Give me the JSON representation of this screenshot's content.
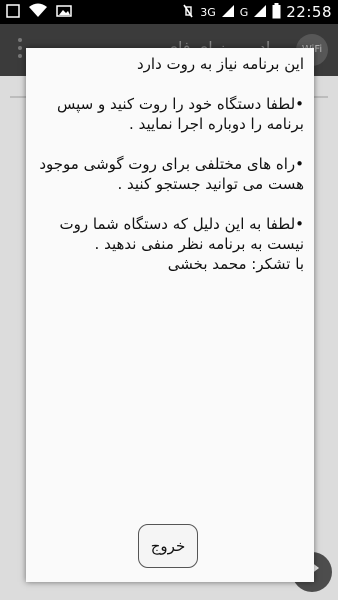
{
  "status_bar": {
    "time": "22:58",
    "network_3g": "3G",
    "network_g": "G"
  },
  "app_bar": {
    "title": "رادیو روز ای فای",
    "icon_text": "WiFi"
  },
  "dialog": {
    "message": "این برنامه نیاز به روت دارد\n\n•لطفا دستگاه  خود را روت کنید و سپس برنامه را دوباره اجرا نمایید .\n\n•راه های مختلفی برای روت گوشی موجود هست می توانید جستجو کنید .\n\n•لطفا به این دلیل که دستگاه شما روت نیست به برنامه نظر منفی ندهید .\nبا تشکر: محمد بخشی",
    "exit_label": "خروج"
  }
}
